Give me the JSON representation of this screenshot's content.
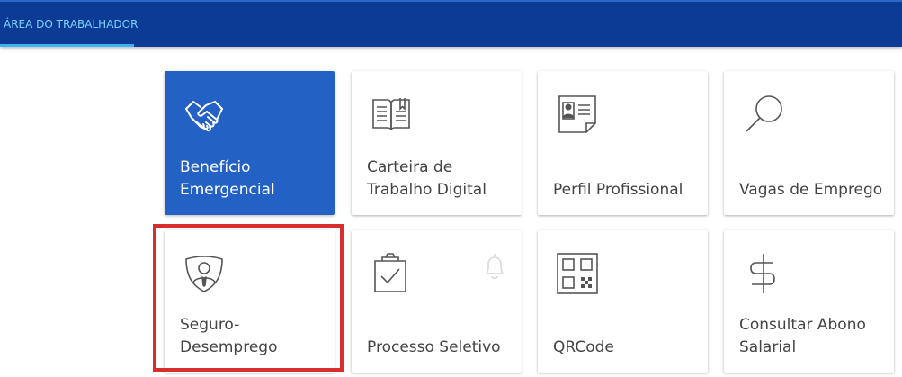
{
  "header": {
    "tab_label": "ÁREA DO TRABALHADOR"
  },
  "colors": {
    "header_background": "#0c3b95",
    "active_tab_indicator": "#3fb2f0",
    "active_card": "#2362c4",
    "highlight_border": "#d92e2e"
  },
  "cards": [
    {
      "label": "Benefício Emergencial",
      "icon": "handshake-icon",
      "selected": true
    },
    {
      "label": "Carteira de Trabalho Digital",
      "icon": "open-book-icon"
    },
    {
      "label": "Perfil Profissional",
      "icon": "profile-card-icon"
    },
    {
      "label": "Vagas de Emprego",
      "icon": "magnifier-icon"
    },
    {
      "label": "Seguro-Desemprego",
      "icon": "shield-person-icon"
    },
    {
      "label": "Processo Seletivo",
      "icon": "clipboard-check-icon",
      "extra_icon": "bell-icon"
    },
    {
      "label": "QRCode",
      "icon": "qrcode-icon"
    },
    {
      "label": "Consultar Abono Salarial",
      "icon": "dollar-icon"
    }
  ]
}
